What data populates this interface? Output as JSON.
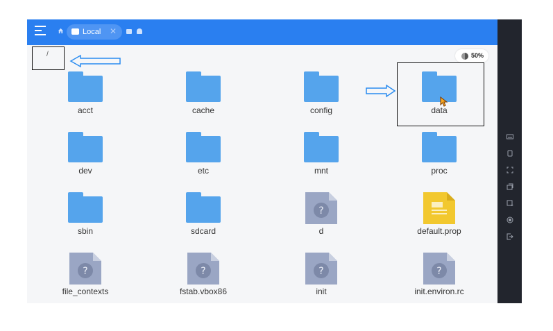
{
  "topbar": {
    "tab_label": "Local",
    "tab_close": "✕"
  },
  "path": "/",
  "storage": {
    "percent_label": "50%",
    "used_fraction": 0.5
  },
  "items": [
    {
      "name": "acct",
      "kind": "folder"
    },
    {
      "name": "cache",
      "kind": "folder"
    },
    {
      "name": "config",
      "kind": "folder"
    },
    {
      "name": "data",
      "kind": "folder"
    },
    {
      "name": "dev",
      "kind": "folder"
    },
    {
      "name": "etc",
      "kind": "folder"
    },
    {
      "name": "mnt",
      "kind": "folder"
    },
    {
      "name": "proc",
      "kind": "folder"
    },
    {
      "name": "sbin",
      "kind": "folder"
    },
    {
      "name": "sdcard",
      "kind": "folder"
    },
    {
      "name": "d",
      "kind": "unknown-file"
    },
    {
      "name": "default.prop",
      "kind": "text-file"
    },
    {
      "name": "file_contexts",
      "kind": "unknown-file"
    },
    {
      "name": "fstab.vbox86",
      "kind": "unknown-file"
    },
    {
      "name": "init",
      "kind": "unknown-file"
    },
    {
      "name": "init.environ.rc",
      "kind": "unknown-file"
    }
  ],
  "colors": {
    "accent": "#2a7ff0",
    "folder": "#55a4ec",
    "unknown_file": "#9aa6c4",
    "text_file": "#f2c82f",
    "annotation_arrow": "#2a8cf0"
  },
  "side_icons": [
    "keyboard-icon",
    "shake-icon",
    "fullscreen-icon",
    "multi-window-icon",
    "screenshot-icon",
    "record-icon",
    "exit-icon"
  ],
  "annotations": {
    "arrow_left": "arrow-left-outline",
    "arrow_right": "arrow-right-outline"
  }
}
